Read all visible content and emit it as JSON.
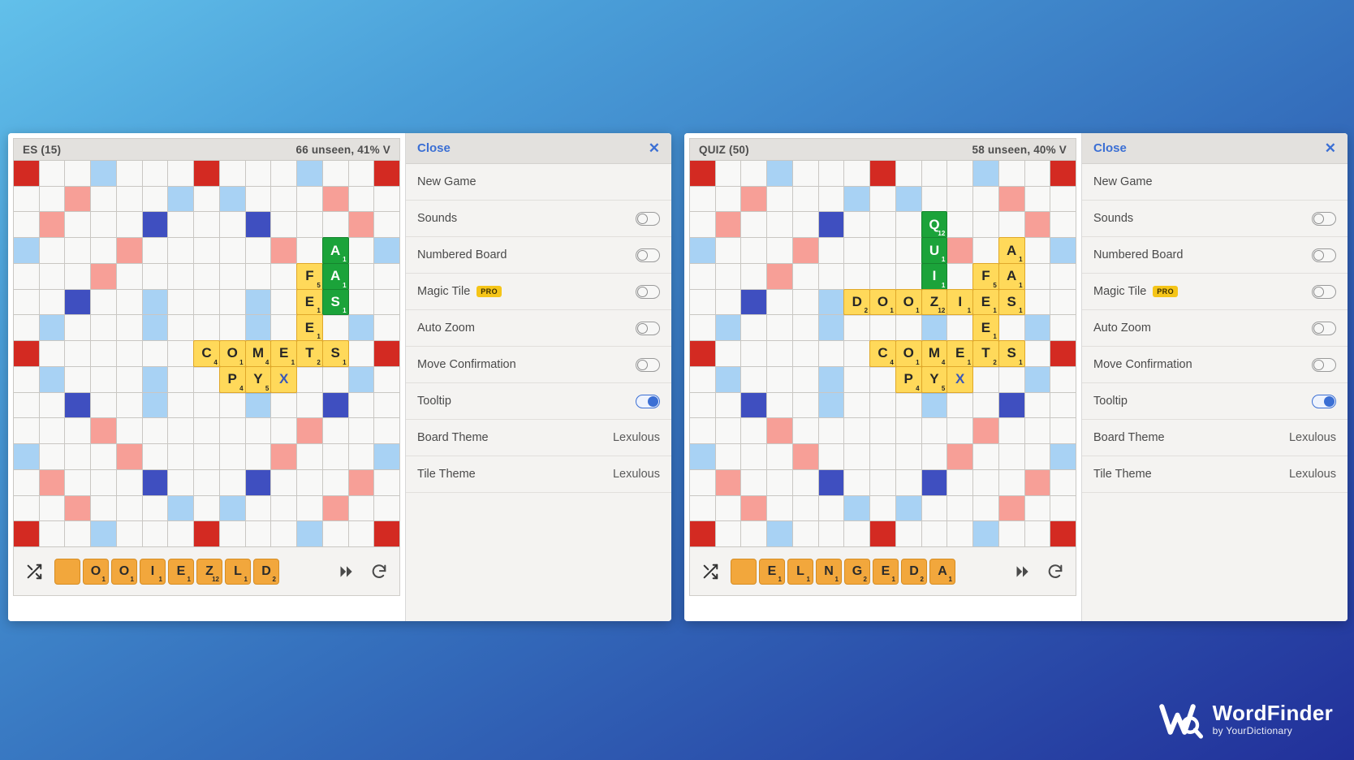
{
  "boards": [
    {
      "id": "board-left",
      "header": {
        "title": "ES (15)",
        "status": "66 unseen, 41% V"
      },
      "tiles": [
        {
          "row": 3,
          "col": 12,
          "letter": "A",
          "points": "1",
          "color": "green"
        },
        {
          "row": 4,
          "col": 11,
          "letter": "F",
          "points": "5",
          "color": "yellow"
        },
        {
          "row": 4,
          "col": 12,
          "letter": "A",
          "points": "1",
          "color": "green"
        },
        {
          "row": 5,
          "col": 11,
          "letter": "E",
          "points": "1",
          "color": "yellow"
        },
        {
          "row": 5,
          "col": 12,
          "letter": "S",
          "points": "1",
          "color": "green"
        },
        {
          "row": 6,
          "col": 11,
          "letter": "E",
          "points": "1",
          "color": "yellow"
        },
        {
          "row": 7,
          "col": 7,
          "letter": "C",
          "points": "4",
          "color": "yellow"
        },
        {
          "row": 7,
          "col": 8,
          "letter": "O",
          "points": "1",
          "color": "yellow"
        },
        {
          "row": 7,
          "col": 9,
          "letter": "M",
          "points": "4",
          "color": "yellow"
        },
        {
          "row": 7,
          "col": 10,
          "letter": "E",
          "points": "1",
          "color": "yellow"
        },
        {
          "row": 7,
          "col": 11,
          "letter": "T",
          "points": "2",
          "color": "yellow"
        },
        {
          "row": 7,
          "col": 12,
          "letter": "S",
          "points": "1",
          "color": "yellow"
        },
        {
          "row": 8,
          "col": 8,
          "letter": "P",
          "points": "4",
          "color": "yellow"
        },
        {
          "row": 8,
          "col": 9,
          "letter": "Y",
          "points": "5",
          "color": "yellow"
        },
        {
          "row": 8,
          "col": 10,
          "letter": "X",
          "points": "",
          "color": "blank"
        }
      ],
      "rack": [
        {
          "letter": "",
          "points": ""
        },
        {
          "letter": "O",
          "points": "1"
        },
        {
          "letter": "O",
          "points": "1"
        },
        {
          "letter": "I",
          "points": "1"
        },
        {
          "letter": "E",
          "points": "1"
        },
        {
          "letter": "Z",
          "points": "12"
        },
        {
          "letter": "L",
          "points": "1"
        },
        {
          "letter": "D",
          "points": "2"
        }
      ]
    },
    {
      "id": "board-right",
      "header": {
        "title": "QUIZ (50)",
        "status": "58 unseen, 40% V"
      },
      "tiles": [
        {
          "row": 2,
          "col": 9,
          "letter": "Q",
          "points": "12",
          "color": "green"
        },
        {
          "row": 3,
          "col": 9,
          "letter": "U",
          "points": "1",
          "color": "green"
        },
        {
          "row": 3,
          "col": 12,
          "letter": "A",
          "points": "1",
          "color": "yellow"
        },
        {
          "row": 4,
          "col": 9,
          "letter": "I",
          "points": "1",
          "color": "green"
        },
        {
          "row": 4,
          "col": 11,
          "letter": "F",
          "points": "5",
          "color": "yellow"
        },
        {
          "row": 4,
          "col": 12,
          "letter": "A",
          "points": "1",
          "color": "yellow"
        },
        {
          "row": 5,
          "col": 6,
          "letter": "D",
          "points": "2",
          "color": "yellow"
        },
        {
          "row": 5,
          "col": 7,
          "letter": "O",
          "points": "1",
          "color": "yellow"
        },
        {
          "row": 5,
          "col": 8,
          "letter": "O",
          "points": "1",
          "color": "yellow"
        },
        {
          "row": 5,
          "col": 9,
          "letter": "Z",
          "points": "12",
          "color": "yellow"
        },
        {
          "row": 5,
          "col": 10,
          "letter": "I",
          "points": "1",
          "color": "yellow"
        },
        {
          "row": 5,
          "col": 11,
          "letter": "E",
          "points": "1",
          "color": "yellow"
        },
        {
          "row": 5,
          "col": 12,
          "letter": "S",
          "points": "1",
          "color": "yellow"
        },
        {
          "row": 6,
          "col": 11,
          "letter": "E",
          "points": "1",
          "color": "yellow"
        },
        {
          "row": 7,
          "col": 7,
          "letter": "C",
          "points": "4",
          "color": "yellow"
        },
        {
          "row": 7,
          "col": 8,
          "letter": "O",
          "points": "1",
          "color": "yellow"
        },
        {
          "row": 7,
          "col": 9,
          "letter": "M",
          "points": "4",
          "color": "yellow"
        },
        {
          "row": 7,
          "col": 10,
          "letter": "E",
          "points": "1",
          "color": "yellow"
        },
        {
          "row": 7,
          "col": 11,
          "letter": "T",
          "points": "2",
          "color": "yellow"
        },
        {
          "row": 7,
          "col": 12,
          "letter": "S",
          "points": "1",
          "color": "yellow"
        },
        {
          "row": 8,
          "col": 8,
          "letter": "P",
          "points": "4",
          "color": "yellow"
        },
        {
          "row": 8,
          "col": 9,
          "letter": "Y",
          "points": "5",
          "color": "yellow"
        },
        {
          "row": 8,
          "col": 10,
          "letter": "X",
          "points": "",
          "color": "blank"
        }
      ],
      "rack": [
        {
          "letter": "",
          "points": ""
        },
        {
          "letter": "E",
          "points": "1"
        },
        {
          "letter": "L",
          "points": "1"
        },
        {
          "letter": "N",
          "points": "1"
        },
        {
          "letter": "G",
          "points": "2"
        },
        {
          "letter": "E",
          "points": "1"
        },
        {
          "letter": "D",
          "points": "2"
        },
        {
          "letter": "A",
          "points": "1"
        }
      ]
    }
  ],
  "settings": {
    "close_label": "Close",
    "close_x": "✕",
    "rows": [
      {
        "label": "New Game",
        "control": "none"
      },
      {
        "label": "Sounds",
        "control": "toggle",
        "on": false
      },
      {
        "label": "Numbered Board",
        "control": "toggle",
        "on": false
      },
      {
        "label": "Magic Tile",
        "control": "toggle",
        "on": false,
        "badge": "PRO"
      },
      {
        "label": "Auto Zoom",
        "control": "toggle",
        "on": false
      },
      {
        "label": "Move Confirmation",
        "control": "toggle",
        "on": false
      },
      {
        "label": "Tooltip",
        "control": "toggle",
        "on": true
      },
      {
        "label": "Board Theme",
        "control": "value",
        "value": "Lexulous"
      },
      {
        "label": "Tile Theme",
        "control": "value",
        "value": "Lexulous"
      }
    ]
  },
  "board_layout": {
    "tw": [
      [
        0,
        0
      ],
      [
        0,
        7
      ],
      [
        0,
        14
      ],
      [
        7,
        0
      ],
      [
        7,
        14
      ],
      [
        14,
        0
      ],
      [
        14,
        7
      ],
      [
        14,
        14
      ]
    ],
    "dw": [
      [
        1,
        2
      ],
      [
        1,
        12
      ],
      [
        2,
        1
      ],
      [
        2,
        13
      ],
      [
        3,
        4
      ],
      [
        3,
        10
      ],
      [
        4,
        3
      ],
      [
        4,
        11
      ],
      [
        10,
        3
      ],
      [
        10,
        11
      ],
      [
        11,
        4
      ],
      [
        11,
        10
      ],
      [
        12,
        1
      ],
      [
        12,
        13
      ],
      [
        13,
        2
      ],
      [
        13,
        12
      ]
    ],
    "tl": [
      [
        2,
        5
      ],
      [
        2,
        9
      ],
      [
        5,
        2
      ],
      [
        5,
        12
      ],
      [
        9,
        2
      ],
      [
        9,
        12
      ],
      [
        12,
        5
      ],
      [
        12,
        9
      ]
    ],
    "dl": [
      [
        0,
        3
      ],
      [
        0,
        11
      ],
      [
        1,
        6
      ],
      [
        1,
        8
      ],
      [
        3,
        0
      ],
      [
        3,
        14
      ],
      [
        5,
        5
      ],
      [
        5,
        9
      ],
      [
        6,
        1
      ],
      [
        6,
        5
      ],
      [
        6,
        9
      ],
      [
        6,
        13
      ],
      [
        8,
        1
      ],
      [
        8,
        5
      ],
      [
        8,
        9
      ],
      [
        8,
        13
      ],
      [
        9,
        5
      ],
      [
        9,
        9
      ],
      [
        11,
        0
      ],
      [
        11,
        14
      ],
      [
        13,
        6
      ],
      [
        13,
        8
      ],
      [
        14,
        3
      ],
      [
        14,
        11
      ]
    ]
  },
  "brand": {
    "logo": "WF",
    "name": "WordFinder",
    "tagline": "by YourDictionary"
  },
  "icons": {
    "shuffle": "shuffle-icon",
    "play": "play-forward-icon",
    "refresh": "refresh-icon"
  }
}
